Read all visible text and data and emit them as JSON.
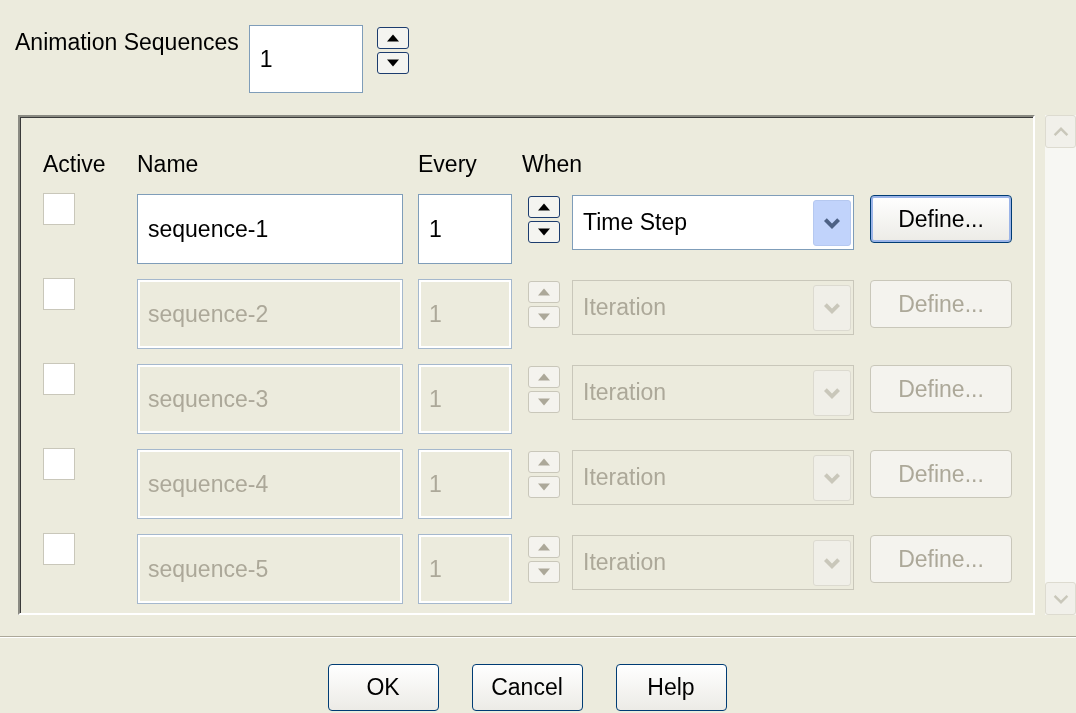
{
  "animation_sequences": {
    "label": "Animation Sequences",
    "value": "1"
  },
  "columns": [
    "Active",
    "Name",
    "Every",
    "When"
  ],
  "rows": [
    {
      "active": false,
      "disabled": false,
      "name": "sequence-1",
      "every": "1",
      "when": "Time Step",
      "define": "Define..."
    },
    {
      "active": false,
      "disabled": true,
      "name": "sequence-2",
      "every": "1",
      "when": "Iteration",
      "define": "Define..."
    },
    {
      "active": false,
      "disabled": true,
      "name": "sequence-3",
      "every": "1",
      "when": "Iteration",
      "define": "Define..."
    },
    {
      "active": false,
      "disabled": true,
      "name": "sequence-4",
      "every": "1",
      "when": "Iteration",
      "define": "Define..."
    },
    {
      "active": false,
      "disabled": true,
      "name": "sequence-5",
      "every": "1",
      "when": "Iteration",
      "define": "Define..."
    }
  ],
  "buttons": [
    "OK",
    "Cancel",
    "Help"
  ]
}
